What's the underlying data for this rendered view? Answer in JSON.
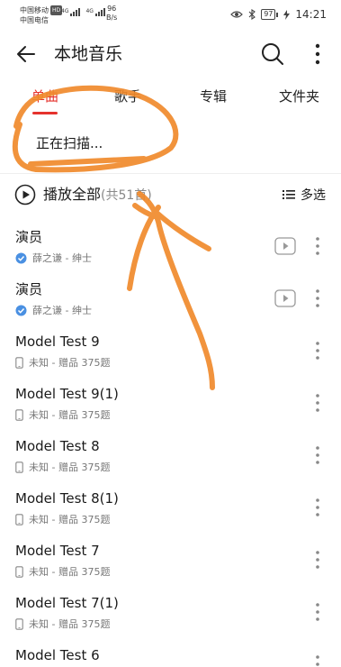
{
  "status_bar": {
    "carrier1": "中国移动",
    "hd": "HD",
    "carrier2": "中国电信",
    "net1": "4G",
    "net2": "4G",
    "speed_value": "96",
    "speed_unit": "B/s",
    "battery": "97",
    "time": "14:21"
  },
  "app_bar": {
    "title": "本地音乐"
  },
  "tabs": [
    {
      "label": "单曲",
      "active": true
    },
    {
      "label": "歌手",
      "active": false
    },
    {
      "label": "专辑",
      "active": false
    },
    {
      "label": "文件夹",
      "active": false
    }
  ],
  "scanning": "正在扫描...",
  "play_all": {
    "label": "播放全部",
    "count": "(共51首)",
    "multi_select": "多选"
  },
  "songs": [
    {
      "title": "演员",
      "subtitle": "薛之谦 - 绅士",
      "source_icon": "verified-icon",
      "has_mv": true
    },
    {
      "title": "演员",
      "subtitle": "薛之谦 - 绅士",
      "source_icon": "verified-icon",
      "has_mv": true
    },
    {
      "title": "Model Test 9",
      "subtitle": "未知 - 赠品 375题",
      "source_icon": "phone-icon",
      "has_mv": false
    },
    {
      "title": "Model Test 9(1)",
      "subtitle": "未知 - 赠品 375题",
      "source_icon": "phone-icon",
      "has_mv": false
    },
    {
      "title": "Model Test 8",
      "subtitle": "未知 - 赠品 375题",
      "source_icon": "phone-icon",
      "has_mv": false
    },
    {
      "title": "Model Test 8(1)",
      "subtitle": "未知 - 赠品 375题",
      "source_icon": "phone-icon",
      "has_mv": false
    },
    {
      "title": "Model Test 7",
      "subtitle": "未知 - 赠品 375题",
      "source_icon": "phone-icon",
      "has_mv": false
    },
    {
      "title": "Model Test 7(1)",
      "subtitle": "未知 - 赠品 375题",
      "source_icon": "phone-icon",
      "has_mv": false
    },
    {
      "title": "Model Test 6",
      "subtitle": "",
      "source_icon": "",
      "has_mv": false
    }
  ],
  "colors": {
    "accent": "#e5322d",
    "verified": "#4a90e2",
    "scribble": "#f08a2c"
  }
}
